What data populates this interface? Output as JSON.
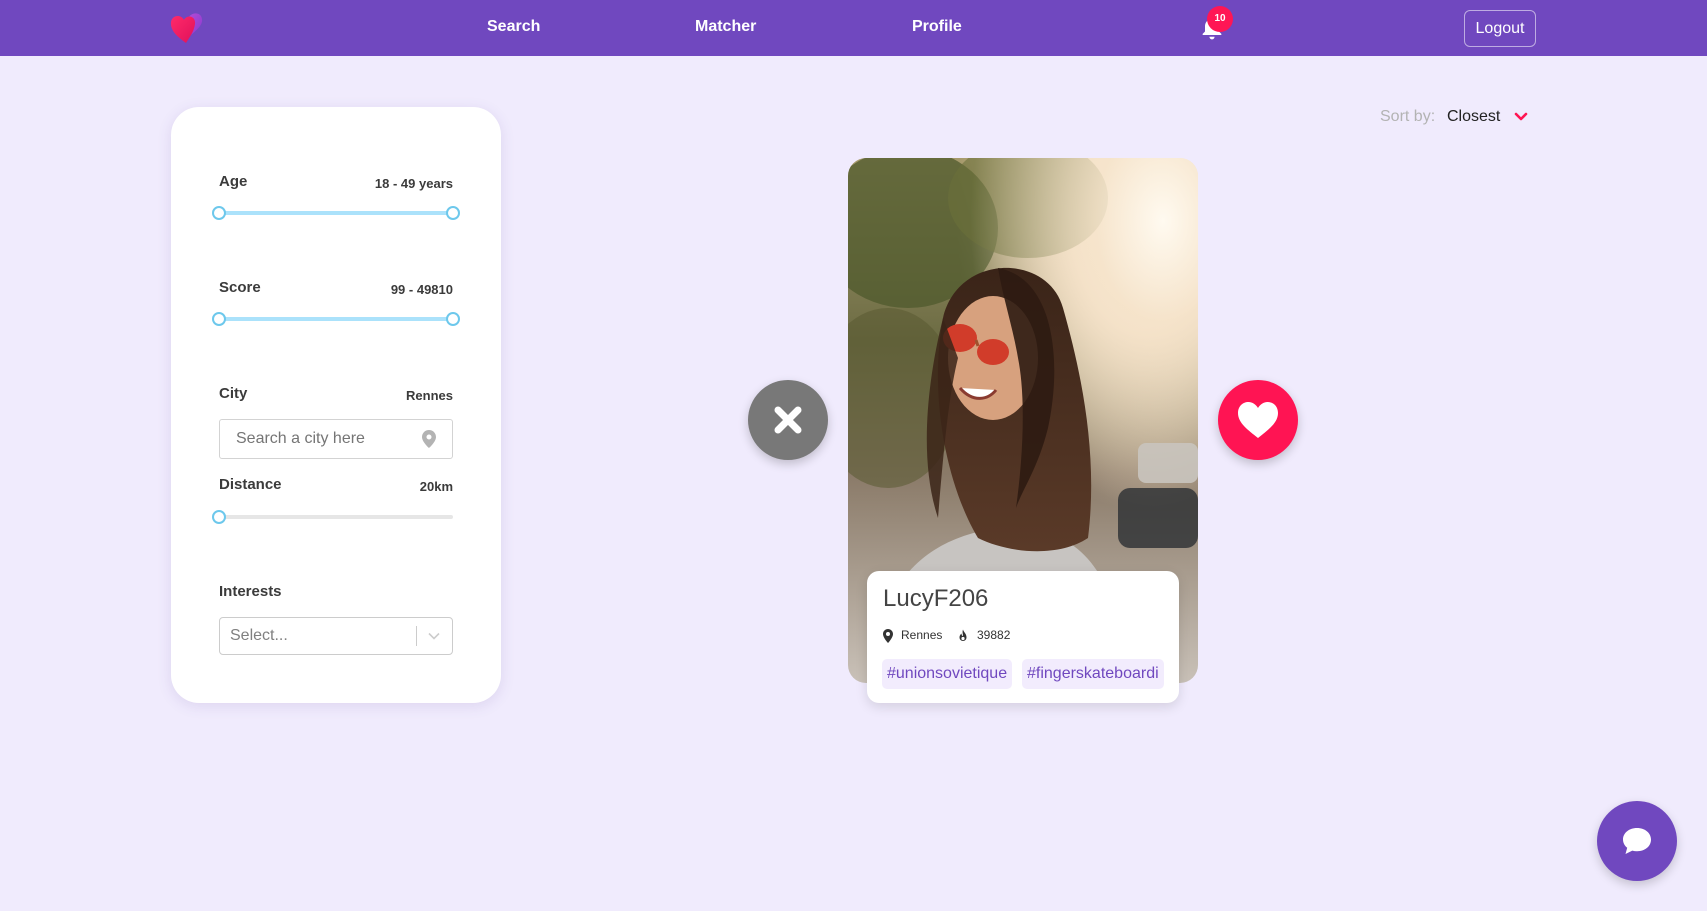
{
  "app": {
    "logo_icon": "double-heart-logo-icon"
  },
  "nav": {
    "links": [
      {
        "label": "Search"
      },
      {
        "label": "Matcher"
      },
      {
        "label": "Profile"
      }
    ],
    "notifications": {
      "count": "10",
      "icon": "bell-icon"
    },
    "logout_label": "Logout"
  },
  "filters": {
    "age": {
      "label": "Age",
      "value": "18 - 49 years",
      "min_fraction": 0.0,
      "max_fraction": 1.0
    },
    "score": {
      "label": "Score",
      "value": "99 - 49810",
      "min_fraction": 0.0,
      "max_fraction": 1.0
    },
    "city": {
      "label": "City",
      "value": "Rennes",
      "placeholder": "Search a city here",
      "icon": "map-pin-icon"
    },
    "distance": {
      "label": "Distance",
      "value": "20km",
      "fraction": 0.0
    },
    "interests": {
      "label": "Interests",
      "placeholder": "Select...",
      "icon": "chevron-down-icon"
    }
  },
  "sort": {
    "label": "Sort by:",
    "value": "Closest",
    "icon": "chevron-down-icon"
  },
  "profile_card": {
    "username": "LucyF206",
    "city": "Rennes",
    "score": "39882",
    "tags": [
      "#unionsovietique",
      "#fingerskateboardi"
    ],
    "photo_description_icon": "profile-photo"
  },
  "actions": {
    "reject_icon": "close-icon",
    "like_icon": "heart-icon"
  },
  "chat": {
    "icon": "chat-bubble-icon"
  },
  "colors": {
    "primary": "#7048bf",
    "accent": "#ff1453",
    "background": "#f0ebfd",
    "slider": "#6dc8ec"
  }
}
